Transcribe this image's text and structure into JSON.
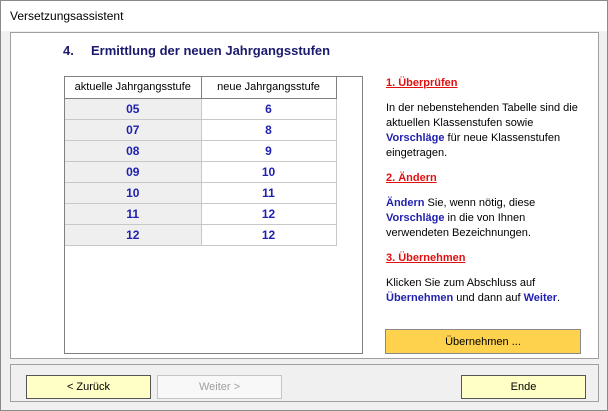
{
  "window": {
    "title": "Versetzungsassistent"
  },
  "step": {
    "number": "4.",
    "title": "Ermittlung der neuen Jahrgangsstufen"
  },
  "table": {
    "headers": [
      "aktuelle Jahrgangsstufe",
      "neue Jahrgangsstufe"
    ],
    "rows": [
      [
        "05",
        "6"
      ],
      [
        "07",
        "8"
      ],
      [
        "08",
        "9"
      ],
      [
        "09",
        "10"
      ],
      [
        "10",
        "11"
      ],
      [
        "11",
        "12"
      ],
      [
        "12",
        "12"
      ]
    ]
  },
  "help": {
    "s1_title": "1. Überprüfen",
    "s1_a": "In der nebenstehenden Tabelle sind die aktuellen Klassenstufen sowie ",
    "s1_kw": "Vorschläge",
    "s1_b": " für neue Klassenstufen eingetragen.",
    "s2_title": "2. Ändern",
    "s2_kw1": "Ändern",
    "s2_a": " Sie, wenn nötig, diese ",
    "s2_kw2": "Vorschläge",
    "s2_b": " in die von Ihnen verwendeten Bezeichnungen.",
    "s3_title": "3. Übernehmen",
    "s3_a": "Klicken Sie zum Abschluss auf ",
    "s3_kw1": "Übernehmen",
    "s3_b": " und dann auf ",
    "s3_kw2": "Weiter",
    "s3_c": "."
  },
  "buttons": {
    "apply": "Übernehmen ...",
    "back": "< Zurück",
    "next": "Weiter >",
    "end": "Ende"
  },
  "colors": {
    "accent_blue": "#1f1fb0",
    "heading_red": "#e01010",
    "apply_button": "#ffd24d",
    "nav_button": "#ffffc6"
  }
}
